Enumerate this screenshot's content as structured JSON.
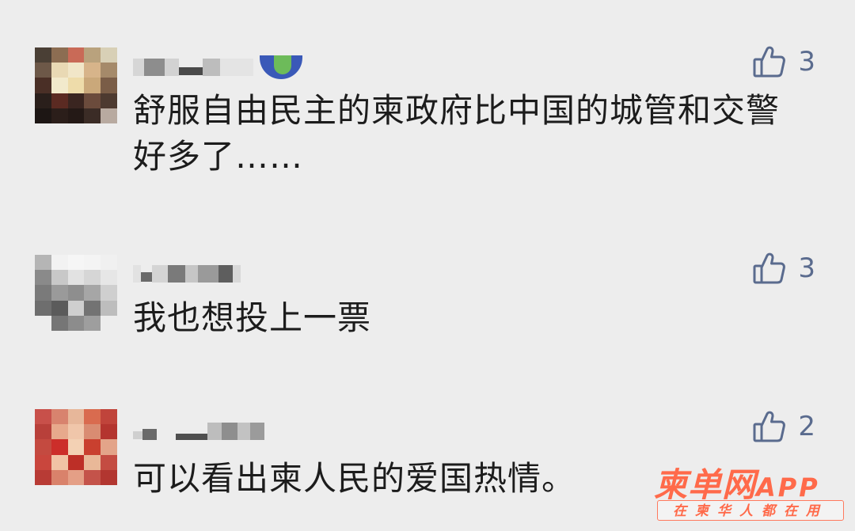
{
  "comments": [
    {
      "text": "舒服自由民主的柬政府比中国的城管和交警好多了……",
      "likes": "3",
      "avatar_state": "pixelated"
    },
    {
      "text": "我也想投上一票",
      "likes": "3",
      "avatar_state": "pixelated"
    },
    {
      "text": "可以看出柬人民的爱国热情。",
      "likes": "2",
      "avatar_state": "pixelated"
    }
  ],
  "icons": {
    "like": "thumbs-up-icon"
  },
  "colors": {
    "background": "#ededed",
    "comment_text": "#1c1c1c",
    "like_accent": "#5a6b8e",
    "watermark": "#ff6a4a"
  },
  "watermark": {
    "logo": "柬单网",
    "app": "APP",
    "tagline": "在柬华人都在用"
  }
}
